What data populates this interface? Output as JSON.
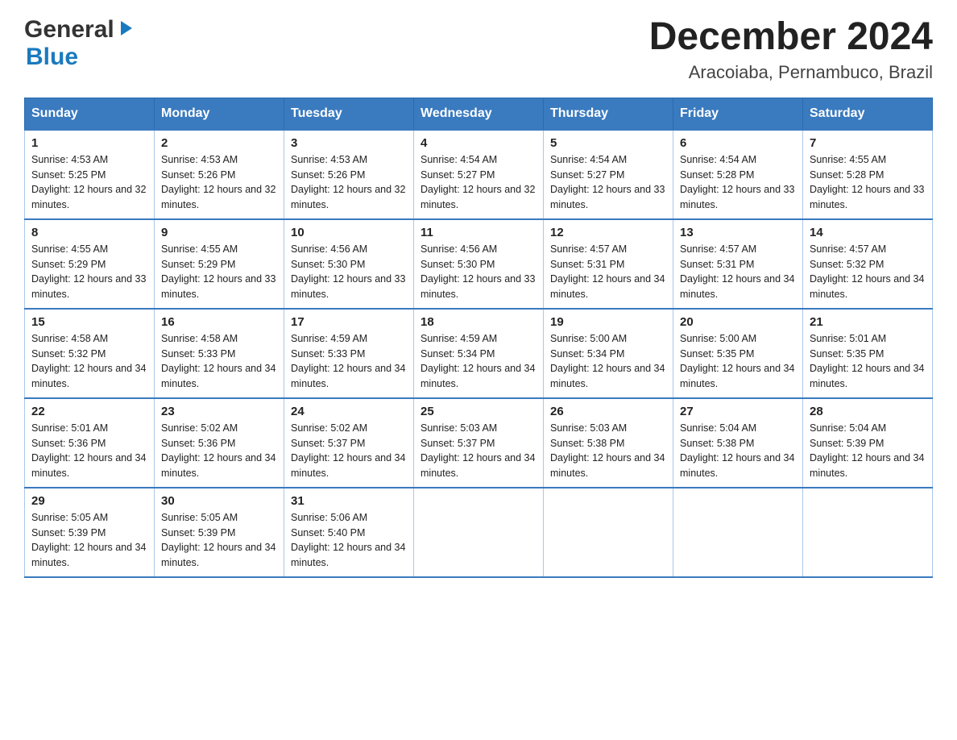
{
  "header": {
    "logo_general": "General",
    "logo_blue": "Blue",
    "month_title": "December 2024",
    "location": "Aracoiaba, Pernambuco, Brazil"
  },
  "weekdays": [
    "Sunday",
    "Monday",
    "Tuesday",
    "Wednesday",
    "Thursday",
    "Friday",
    "Saturday"
  ],
  "weeks": [
    [
      {
        "day": "1",
        "sunrise": "4:53 AM",
        "sunset": "5:25 PM",
        "daylight": "12 hours and 32 minutes."
      },
      {
        "day": "2",
        "sunrise": "4:53 AM",
        "sunset": "5:26 PM",
        "daylight": "12 hours and 32 minutes."
      },
      {
        "day": "3",
        "sunrise": "4:53 AM",
        "sunset": "5:26 PM",
        "daylight": "12 hours and 32 minutes."
      },
      {
        "day": "4",
        "sunrise": "4:54 AM",
        "sunset": "5:27 PM",
        "daylight": "12 hours and 32 minutes."
      },
      {
        "day": "5",
        "sunrise": "4:54 AM",
        "sunset": "5:27 PM",
        "daylight": "12 hours and 33 minutes."
      },
      {
        "day": "6",
        "sunrise": "4:54 AM",
        "sunset": "5:28 PM",
        "daylight": "12 hours and 33 minutes."
      },
      {
        "day": "7",
        "sunrise": "4:55 AM",
        "sunset": "5:28 PM",
        "daylight": "12 hours and 33 minutes."
      }
    ],
    [
      {
        "day": "8",
        "sunrise": "4:55 AM",
        "sunset": "5:29 PM",
        "daylight": "12 hours and 33 minutes."
      },
      {
        "day": "9",
        "sunrise": "4:55 AM",
        "sunset": "5:29 PM",
        "daylight": "12 hours and 33 minutes."
      },
      {
        "day": "10",
        "sunrise": "4:56 AM",
        "sunset": "5:30 PM",
        "daylight": "12 hours and 33 minutes."
      },
      {
        "day": "11",
        "sunrise": "4:56 AM",
        "sunset": "5:30 PM",
        "daylight": "12 hours and 33 minutes."
      },
      {
        "day": "12",
        "sunrise": "4:57 AM",
        "sunset": "5:31 PM",
        "daylight": "12 hours and 34 minutes."
      },
      {
        "day": "13",
        "sunrise": "4:57 AM",
        "sunset": "5:31 PM",
        "daylight": "12 hours and 34 minutes."
      },
      {
        "day": "14",
        "sunrise": "4:57 AM",
        "sunset": "5:32 PM",
        "daylight": "12 hours and 34 minutes."
      }
    ],
    [
      {
        "day": "15",
        "sunrise": "4:58 AM",
        "sunset": "5:32 PM",
        "daylight": "12 hours and 34 minutes."
      },
      {
        "day": "16",
        "sunrise": "4:58 AM",
        "sunset": "5:33 PM",
        "daylight": "12 hours and 34 minutes."
      },
      {
        "day": "17",
        "sunrise": "4:59 AM",
        "sunset": "5:33 PM",
        "daylight": "12 hours and 34 minutes."
      },
      {
        "day": "18",
        "sunrise": "4:59 AM",
        "sunset": "5:34 PM",
        "daylight": "12 hours and 34 minutes."
      },
      {
        "day": "19",
        "sunrise": "5:00 AM",
        "sunset": "5:34 PM",
        "daylight": "12 hours and 34 minutes."
      },
      {
        "day": "20",
        "sunrise": "5:00 AM",
        "sunset": "5:35 PM",
        "daylight": "12 hours and 34 minutes."
      },
      {
        "day": "21",
        "sunrise": "5:01 AM",
        "sunset": "5:35 PM",
        "daylight": "12 hours and 34 minutes."
      }
    ],
    [
      {
        "day": "22",
        "sunrise": "5:01 AM",
        "sunset": "5:36 PM",
        "daylight": "12 hours and 34 minutes."
      },
      {
        "day": "23",
        "sunrise": "5:02 AM",
        "sunset": "5:36 PM",
        "daylight": "12 hours and 34 minutes."
      },
      {
        "day": "24",
        "sunrise": "5:02 AM",
        "sunset": "5:37 PM",
        "daylight": "12 hours and 34 minutes."
      },
      {
        "day": "25",
        "sunrise": "5:03 AM",
        "sunset": "5:37 PM",
        "daylight": "12 hours and 34 minutes."
      },
      {
        "day": "26",
        "sunrise": "5:03 AM",
        "sunset": "5:38 PM",
        "daylight": "12 hours and 34 minutes."
      },
      {
        "day": "27",
        "sunrise": "5:04 AM",
        "sunset": "5:38 PM",
        "daylight": "12 hours and 34 minutes."
      },
      {
        "day": "28",
        "sunrise": "5:04 AM",
        "sunset": "5:39 PM",
        "daylight": "12 hours and 34 minutes."
      }
    ],
    [
      {
        "day": "29",
        "sunrise": "5:05 AM",
        "sunset": "5:39 PM",
        "daylight": "12 hours and 34 minutes."
      },
      {
        "day": "30",
        "sunrise": "5:05 AM",
        "sunset": "5:39 PM",
        "daylight": "12 hours and 34 minutes."
      },
      {
        "day": "31",
        "sunrise": "5:06 AM",
        "sunset": "5:40 PM",
        "daylight": "12 hours and 34 minutes."
      },
      null,
      null,
      null,
      null
    ]
  ],
  "labels": {
    "sunrise_prefix": "Sunrise: ",
    "sunset_prefix": "Sunset: ",
    "daylight_prefix": "Daylight: "
  }
}
